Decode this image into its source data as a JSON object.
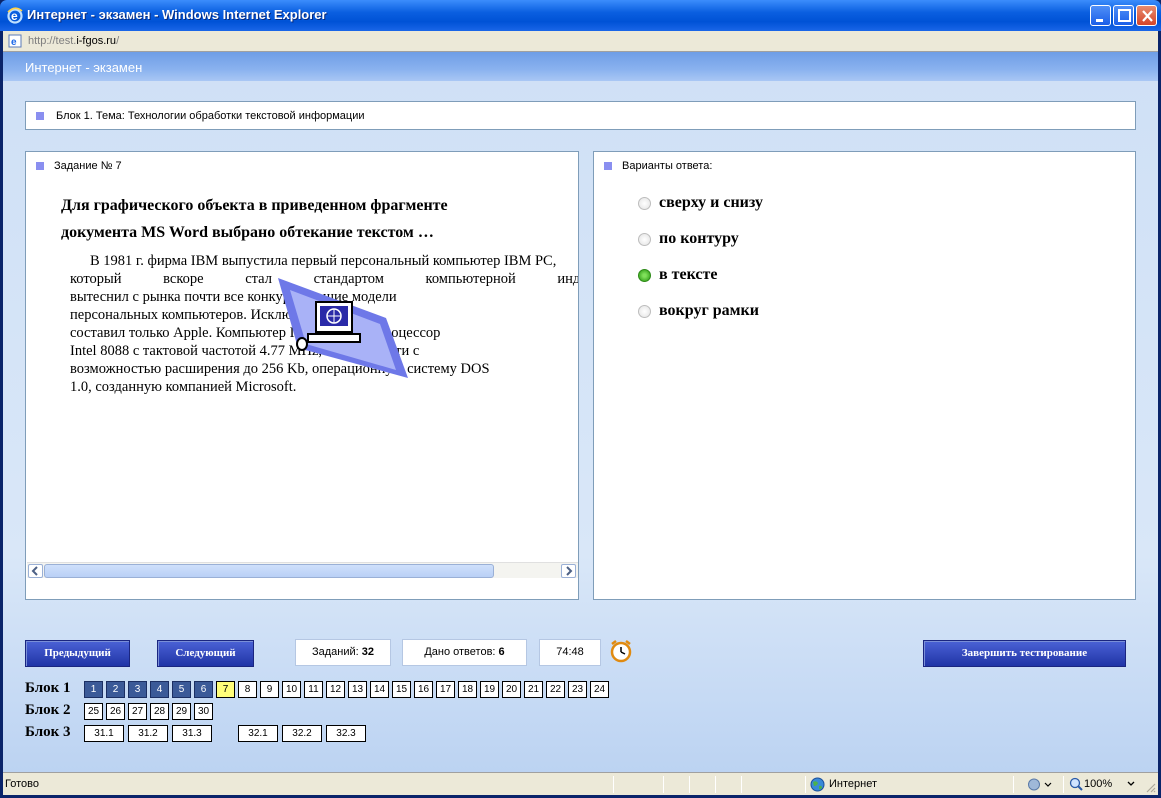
{
  "window": {
    "title": "Интернет - экзамен - Windows Internet Explorer",
    "colors": {
      "titlebar": "#0052d6",
      "close": "#d4452a"
    }
  },
  "address": {
    "url_prefix": "http://test.",
    "url_domain": "i-fgos.ru",
    "url_suffix": "/"
  },
  "app": {
    "title": "Интернет - экзамен"
  },
  "block_header": "Блок 1. Тема: Технологии обработки текстовой информации",
  "task": {
    "label": "Задание № 7",
    "question_line1": "Для графического объекта в приведенном фрагменте",
    "question_line2": "документа MS Word выбрано обтекание текстом …",
    "fragment_lines": [
      "В 1981 г. фирма IBM выпустила первый персональный компьютер IBM PC,",
      "который вскоре стал стандартом компьютерной индустрии и",
      "вытеснил с рынка почти все конкурирующие модели",
      "персональных компьютеров. Исключение",
      "составил только Apple. Компьютер IBM PC имел процессор",
      "Intel 8088 с тактовой частотой 4.77 MHz, 16 Kb памяти с",
      "возможностью расширения до 256 Kb, операционную систему DOS",
      "1.0, созданную компанией Microsoft."
    ]
  },
  "answers": {
    "label": "Варианты ответа:",
    "options": [
      {
        "text": "сверху и снизу",
        "selected": false
      },
      {
        "text": "по контуру",
        "selected": false
      },
      {
        "text": "в тексте",
        "selected": true
      },
      {
        "text": "вокруг рамки",
        "selected": false
      }
    ],
    "selected_color": "#2f9c16"
  },
  "controls": {
    "prev_label": "Предыдущий",
    "next_label": "Следующий",
    "tasks_label": "Заданий:",
    "tasks_value": "32",
    "answered_label": "Дано ответов:",
    "answered_value": "6",
    "timer": "74:48",
    "finish_label": "Завершить тестирование"
  },
  "blocks": [
    {
      "label": "Блок 1",
      "items": [
        "1",
        "2",
        "3",
        "4",
        "5",
        "6",
        "7",
        "8",
        "9",
        "10",
        "11",
        "12",
        "13",
        "14",
        "15",
        "16",
        "17",
        "18",
        "19",
        "20",
        "21",
        "22",
        "23",
        "24"
      ],
      "answered": 6,
      "current": "7"
    },
    {
      "label": "Блок 2",
      "items": [
        "25",
        "26",
        "27",
        "28",
        "29",
        "30"
      ]
    },
    {
      "label": "Блок 3",
      "items": [
        "31.1",
        "31.2",
        "31.3",
        "32.1",
        "32.2",
        "32.3"
      ]
    }
  ],
  "status": {
    "left": "Готово",
    "zone": "Интернет",
    "zoom": "100%"
  },
  "colors": {
    "answered_box": "#3b5a98",
    "current_box": "#fffe7a",
    "nav_button": "#2034a6",
    "bullet": "#8a8ff0"
  }
}
